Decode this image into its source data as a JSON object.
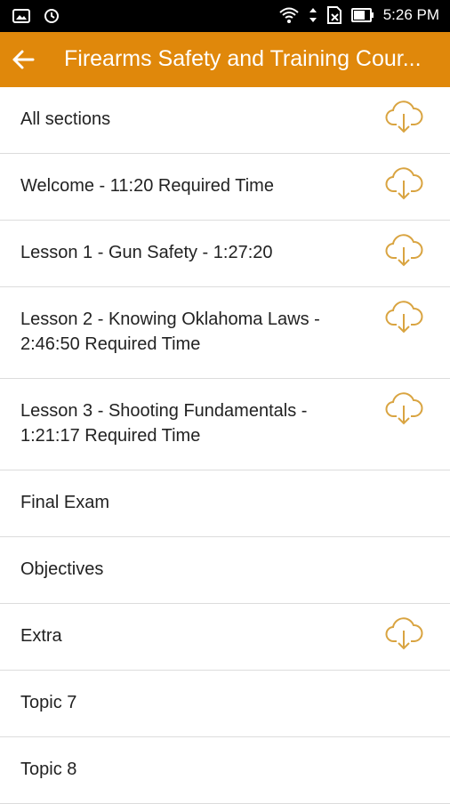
{
  "status_bar": {
    "time": "5:26 PM"
  },
  "app_bar": {
    "title": "Firearms Safety and Training Cour..."
  },
  "sections": [
    {
      "label": "All sections",
      "download": true
    },
    {
      "label": "Welcome - 11:20 Required Time",
      "download": true
    },
    {
      "label": "Lesson 1 - Gun Safety - 1:27:20",
      "download": true
    },
    {
      "label": "Lesson 2 - Knowing Oklahoma Laws - 2:46:50 Required Time",
      "download": true
    },
    {
      "label": "Lesson 3 - Shooting Fundamentals - 1:21:17 Required Time",
      "download": true
    },
    {
      "label": "Final Exam",
      "download": false
    },
    {
      "label": "Objectives",
      "download": false
    },
    {
      "label": "Extra",
      "download": true
    },
    {
      "label": "Topic 7",
      "download": false
    },
    {
      "label": "Topic 8",
      "download": false
    }
  ],
  "colors": {
    "accent": "#e0880b",
    "icon": "#d9a441"
  }
}
